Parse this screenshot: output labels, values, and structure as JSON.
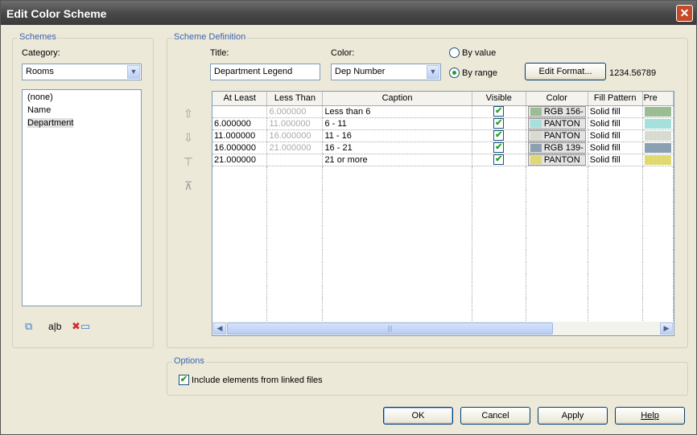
{
  "title": "Edit Color Scheme",
  "schemes": {
    "group_label": "Schemes",
    "category_label": "Category:",
    "category_value": "Rooms",
    "items": [
      "(none)",
      "Name",
      "Department"
    ],
    "selected": "Department",
    "rename_glyph": "a|b"
  },
  "definition": {
    "group_label": "Scheme Definition",
    "title_label": "Title:",
    "title_value": "Department Legend",
    "color_label": "Color:",
    "color_value": "Dep Number",
    "by_value": "By value",
    "by_range": "By range",
    "edit_format": "Edit Format...",
    "format_sample": "1234.56789",
    "columns": [
      "At Least",
      "Less Than",
      "Caption",
      "Visible",
      "Color",
      "Fill Pattern",
      "Pre"
    ],
    "rows": [
      {
        "at_least": "",
        "less_than": "6.000000",
        "caption": "Less than 6",
        "visible": true,
        "color": "RGB 156-",
        "swatch": "#9cbc94",
        "fill": "Solid fill"
      },
      {
        "at_least": "6.000000",
        "less_than": "11.000000",
        "caption": "6 - 11",
        "visible": true,
        "color": "PANTON",
        "swatch": "#a6e0dc",
        "fill": "Solid fill"
      },
      {
        "at_least": "11.000000",
        "less_than": "16.000000",
        "caption": "11 - 16",
        "visible": true,
        "color": "PANTON",
        "swatch": "#d8dcd0",
        "fill": "Solid fill"
      },
      {
        "at_least": "16.000000",
        "less_than": "21.000000",
        "caption": "16 - 21",
        "visible": true,
        "color": "RGB 139-",
        "swatch": "#8ba0b0",
        "fill": "Solid fill"
      },
      {
        "at_least": "21.000000",
        "less_than": "",
        "caption": "21 or more",
        "visible": true,
        "color": "PANTON",
        "swatch": "#e0d870",
        "fill": "Solid fill"
      }
    ]
  },
  "options": {
    "group_label": "Options",
    "include_linked": "Include elements from linked files",
    "include_checked": true
  },
  "buttons": {
    "ok": "OK",
    "cancel": "Cancel",
    "apply": "Apply",
    "help": "Help"
  }
}
